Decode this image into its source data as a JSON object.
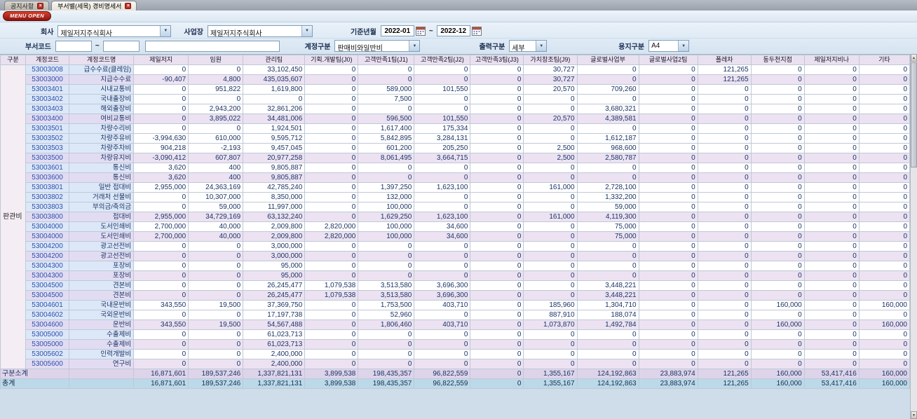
{
  "icons": {
    "close": "×",
    "dropdown": "▼",
    "scroll_up": "▲",
    "scroll_down": "▼"
  },
  "colors": {
    "menu_button_red": "#a81810",
    "tab_close_red": "#c03028",
    "header_bg": "#e9e0f0",
    "subtotal_row_bg": "#ded4ea",
    "total_row_bg": "#bcd9e9",
    "code_text_blue": "#2d4fae",
    "detail_cell_bg": "#ffffff",
    "sub_cell_bg": "#ece2f2"
  },
  "tabs": [
    {
      "label": "공지사항"
    },
    {
      "label": "부서별(세목) 경비명세서"
    }
  ],
  "menu_open_label": "MENU OPEN",
  "filters": {
    "company_label": "회사",
    "company_value": "제일저지주식회사",
    "workplace_label": "사업장",
    "workplace_value": "제일저지주식회사",
    "period_label": "기준년월",
    "period_from": "2022-01",
    "period_to": "2022-12",
    "range_separator": "~",
    "dept_code_label": "부서코드",
    "dept_code_from": "",
    "dept_code_to": "",
    "dept_name_value": "",
    "account_group_label": "계정구분",
    "account_group_value": "판매비와일반비",
    "output_group_label": "출력구분",
    "output_group_value": "세부",
    "paper_group_label": "용지구분",
    "paper_group_value": "A4"
  },
  "table": {
    "headers": [
      "구분",
      "계정코드",
      "계정코드명",
      "제일저지",
      "임원",
      "관리팀",
      "기획.개발팀(J0)",
      "고객만족1팀(J1)",
      "고객만족2팀(J2)",
      "고객만족3팀(J3)",
      "가치창조팀(J9)",
      "글로벌사업부",
      "글로벌사업2팀",
      "폴레차",
      "동두천지점",
      "제일저지비나",
      "기타"
    ],
    "group_label": "판관비",
    "rows": [
      {
        "code": "53003008",
        "name": "급수수료(클레임)",
        "type": "detail",
        "values": [
          "0",
          "0",
          "33,102,450",
          "0",
          "0",
          "0",
          "0",
          "30,727",
          "0",
          "0",
          "121,265",
          "0",
          "0",
          "0"
        ]
      },
      {
        "code": "53003000",
        "name": "지급수수료",
        "type": "sub",
        "values": [
          "-90,407",
          "4,800",
          "435,035,607",
          "0",
          "0",
          "0",
          "0",
          "30,727",
          "0",
          "0",
          "121,265",
          "0",
          "0",
          "0"
        ]
      },
      {
        "code": "53003401",
        "name": "시내교통비",
        "type": "detail",
        "values": [
          "0",
          "951,822",
          "1,619,800",
          "0",
          "589,000",
          "101,550",
          "0",
          "20,570",
          "709,260",
          "0",
          "0",
          "0",
          "0",
          "0"
        ]
      },
      {
        "code": "53003402",
        "name": "국내출장비",
        "type": "detail",
        "values": [
          "0",
          "0",
          "0",
          "0",
          "7,500",
          "0",
          "0",
          "0",
          "0",
          "0",
          "0",
          "0",
          "0",
          "0"
        ]
      },
      {
        "code": "53003403",
        "name": "해외출장비",
        "type": "detail",
        "values": [
          "0",
          "2,943,200",
          "32,861,206",
          "0",
          "0",
          "0",
          "0",
          "0",
          "3,680,321",
          "0",
          "0",
          "0",
          "0",
          "0"
        ]
      },
      {
        "code": "53003400",
        "name": "여비교통비",
        "type": "sub",
        "values": [
          "0",
          "3,895,022",
          "34,481,006",
          "0",
          "596,500",
          "101,550",
          "0",
          "20,570",
          "4,389,581",
          "0",
          "0",
          "0",
          "0",
          "0"
        ]
      },
      {
        "code": "53003501",
        "name": "차량수리비",
        "type": "detail",
        "values": [
          "0",
          "0",
          "1,924,501",
          "0",
          "1,617,400",
          "175,334",
          "0",
          "0",
          "0",
          "0",
          "0",
          "0",
          "0",
          "0"
        ]
      },
      {
        "code": "53003502",
        "name": "차량주유비",
        "type": "detail",
        "values": [
          "-3,994,630",
          "610,000",
          "9,595,712",
          "0",
          "5,842,895",
          "3,284,131",
          "0",
          "0",
          "1,612,187",
          "0",
          "0",
          "0",
          "0",
          "0"
        ]
      },
      {
        "code": "53003503",
        "name": "차량주차비",
        "type": "detail",
        "values": [
          "904,218",
          "-2,193",
          "9,457,045",
          "0",
          "601,200",
          "205,250",
          "0",
          "2,500",
          "968,600",
          "0",
          "0",
          "0",
          "0",
          "0"
        ]
      },
      {
        "code": "53003500",
        "name": "차량유지비",
        "type": "sub",
        "values": [
          "-3,090,412",
          "607,807",
          "20,977,258",
          "0",
          "8,061,495",
          "3,664,715",
          "0",
          "2,500",
          "2,580,787",
          "0",
          "0",
          "0",
          "0",
          "0"
        ]
      },
      {
        "code": "53003601",
        "name": "통신비",
        "type": "detail",
        "values": [
          "3,620",
          "400",
          "9,805,887",
          "0",
          "0",
          "0",
          "0",
          "0",
          "0",
          "0",
          "0",
          "0",
          "0",
          "0"
        ]
      },
      {
        "code": "53003600",
        "name": "통신비",
        "type": "sub",
        "values": [
          "3,620",
          "400",
          "9,805,887",
          "0",
          "0",
          "0",
          "0",
          "0",
          "0",
          "0",
          "0",
          "0",
          "0",
          "0"
        ]
      },
      {
        "code": "53003801",
        "name": "일반 접대비",
        "type": "detail",
        "values": [
          "2,955,000",
          "24,363,169",
          "42,785,240",
          "0",
          "1,397,250",
          "1,623,100",
          "0",
          "161,000",
          "2,728,100",
          "0",
          "0",
          "0",
          "0",
          "0"
        ]
      },
      {
        "code": "53003802",
        "name": "거래처 선물비",
        "type": "detail",
        "values": [
          "0",
          "10,307,000",
          "8,350,000",
          "0",
          "132,000",
          "0",
          "0",
          "0",
          "1,332,200",
          "0",
          "0",
          "0",
          "0",
          "0"
        ]
      },
      {
        "code": "53003803",
        "name": "부의금/축의금",
        "type": "detail",
        "values": [
          "0",
          "59,000",
          "11,997,000",
          "0",
          "100,000",
          "0",
          "0",
          "0",
          "59,000",
          "0",
          "0",
          "0",
          "0",
          "0"
        ]
      },
      {
        "code": "53003800",
        "name": "접대비",
        "type": "sub",
        "values": [
          "2,955,000",
          "34,729,169",
          "63,132,240",
          "0",
          "1,629,250",
          "1,623,100",
          "0",
          "161,000",
          "4,119,300",
          "0",
          "0",
          "0",
          "0",
          "0"
        ]
      },
      {
        "code": "53004000",
        "name": "도서인쇄비",
        "type": "detail",
        "values": [
          "2,700,000",
          "40,000",
          "2,009,800",
          "2,820,000",
          "100,000",
          "34,600",
          "0",
          "0",
          "75,000",
          "0",
          "0",
          "0",
          "0",
          "0"
        ]
      },
      {
        "code": "53004000",
        "name": "도서인쇄비",
        "type": "sub",
        "values": [
          "2,700,000",
          "40,000",
          "2,009,800",
          "2,820,000",
          "100,000",
          "34,600",
          "0",
          "0",
          "75,000",
          "0",
          "0",
          "0",
          "0",
          "0"
        ]
      },
      {
        "code": "53004200",
        "name": "광고선전비",
        "type": "detail",
        "values": [
          "0",
          "0",
          "3,000,000",
          "0",
          "0",
          "0",
          "0",
          "0",
          "0",
          "0",
          "0",
          "0",
          "0",
          "0"
        ]
      },
      {
        "code": "53004200",
        "name": "광고선전비",
        "type": "sub",
        "values": [
          "0",
          "0",
          "3,000,000",
          "0",
          "0",
          "0",
          "0",
          "0",
          "0",
          "0",
          "0",
          "0",
          "0",
          "0"
        ]
      },
      {
        "code": "53004300",
        "name": "포장비",
        "type": "detail",
        "values": [
          "0",
          "0",
          "95,000",
          "0",
          "0",
          "0",
          "0",
          "0",
          "0",
          "0",
          "0",
          "0",
          "0",
          "0"
        ]
      },
      {
        "code": "53004300",
        "name": "포장비",
        "type": "sub",
        "values": [
          "0",
          "0",
          "95,000",
          "0",
          "0",
          "0",
          "0",
          "0",
          "0",
          "0",
          "0",
          "0",
          "0",
          "0"
        ]
      },
      {
        "code": "53004500",
        "name": "견본비",
        "type": "detail",
        "values": [
          "0",
          "0",
          "26,245,477",
          "1,079,538",
          "3,513,580",
          "3,696,300",
          "0",
          "0",
          "3,448,221",
          "0",
          "0",
          "0",
          "0",
          "0"
        ]
      },
      {
        "code": "53004500",
        "name": "견본비",
        "type": "sub",
        "values": [
          "0",
          "0",
          "26,245,477",
          "1,079,538",
          "3,513,580",
          "3,696,300",
          "0",
          "0",
          "3,448,221",
          "0",
          "0",
          "0",
          "0",
          "0"
        ]
      },
      {
        "code": "53004601",
        "name": "국내운반비",
        "type": "detail",
        "values": [
          "343,550",
          "19,500",
          "37,369,750",
          "0",
          "1,753,500",
          "403,710",
          "0",
          "185,960",
          "1,304,710",
          "0",
          "0",
          "160,000",
          "0",
          "160,000"
        ]
      },
      {
        "code": "53004602",
        "name": "국외운반비",
        "type": "detail",
        "values": [
          "0",
          "0",
          "17,197,738",
          "0",
          "52,960",
          "0",
          "0",
          "887,910",
          "188,074",
          "0",
          "0",
          "0",
          "0",
          "0"
        ]
      },
      {
        "code": "53004600",
        "name": "운반비",
        "type": "sub",
        "values": [
          "343,550",
          "19,500",
          "54,567,488",
          "0",
          "1,806,460",
          "403,710",
          "0",
          "1,073,870",
          "1,492,784",
          "0",
          "0",
          "160,000",
          "0",
          "160,000"
        ]
      },
      {
        "code": "53005000",
        "name": "수출제비",
        "type": "detail",
        "values": [
          "0",
          "0",
          "61,023,713",
          "0",
          "0",
          "0",
          "0",
          "0",
          "0",
          "0",
          "0",
          "0",
          "0",
          "0"
        ]
      },
      {
        "code": "53005000",
        "name": "수출제비",
        "type": "sub",
        "values": [
          "0",
          "0",
          "61,023,713",
          "0",
          "0",
          "0",
          "0",
          "0",
          "0",
          "0",
          "0",
          "0",
          "0",
          "0"
        ]
      },
      {
        "code": "53005602",
        "name": "인력개발비",
        "type": "detail",
        "values": [
          "0",
          "0",
          "2,400,000",
          "0",
          "0",
          "0",
          "0",
          "0",
          "0",
          "0",
          "0",
          "0",
          "0",
          "0"
        ]
      },
      {
        "code": "53005600",
        "name": "연구비",
        "type": "sub",
        "values": [
          "0",
          "0",
          "2,400,000",
          "0",
          "0",
          "0",
          "0",
          "0",
          "0",
          "0",
          "0",
          "0",
          "0",
          "0"
        ]
      }
    ],
    "subtotal": {
      "label": "구분소계",
      "values": [
        "16,871,601",
        "189,537,246",
        "1,337,821,131",
        "3,899,538",
        "198,435,357",
        "96,822,559",
        "0",
        "1,355,167",
        "124,192,863",
        "23,883,974",
        "121,265",
        "160,000",
        "53,417,416",
        "160,000"
      ]
    },
    "total": {
      "label": "총계",
      "values": [
        "16,871,601",
        "189,537,246",
        "1,337,821,131",
        "3,899,538",
        "198,435,357",
        "96,822,559",
        "0",
        "1,355,167",
        "124,192,863",
        "23,883,974",
        "121,265",
        "160,000",
        "53,417,416",
        "160,000"
      ]
    }
  }
}
